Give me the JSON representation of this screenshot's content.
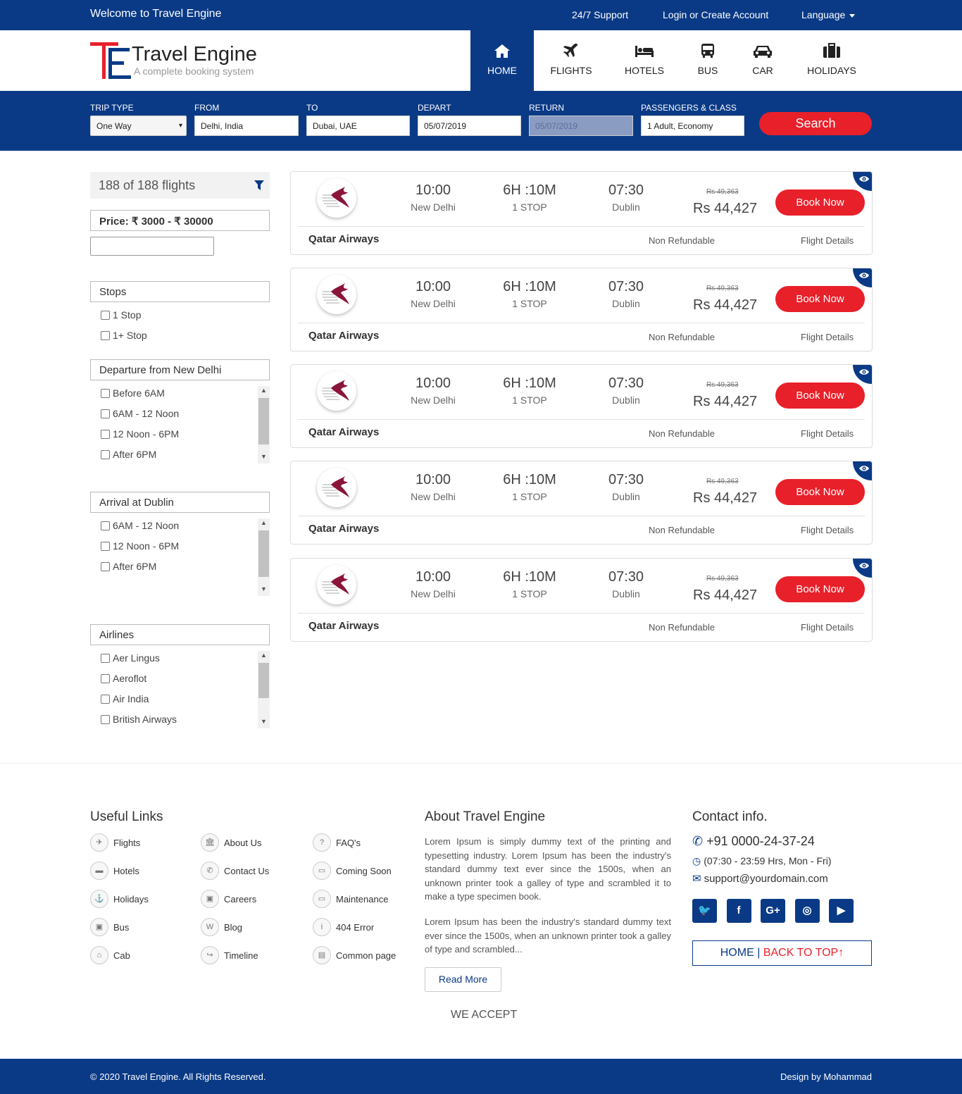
{
  "topbar": {
    "welcome": "Welcome to Travel Engine",
    "support": "24/7 Support",
    "login": "Login or Create Account",
    "language": "Language"
  },
  "logo": {
    "name": "Travel Engine",
    "tagline": "A complete booking system",
    "mark": "TE"
  },
  "nav": [
    {
      "label": "HOME",
      "icon": "home-icon",
      "active": true
    },
    {
      "label": "FLIGHTS",
      "icon": "plane-icon"
    },
    {
      "label": "HOTELS",
      "icon": "bed-icon"
    },
    {
      "label": "BUS",
      "icon": "bus-icon"
    },
    {
      "label": "CAR",
      "icon": "car-icon"
    },
    {
      "label": "HOLIDAYS",
      "icon": "suitcase-icon"
    }
  ],
  "search": {
    "trip_type_label": "TRIP TYPE",
    "trip_type": "One Way",
    "from_label": "FROM",
    "from": "Delhi, India",
    "to_label": "TO",
    "to": "Dubai, UAE",
    "depart_label": "DEPART",
    "depart": "05/07/2019",
    "return_label": "RETURN",
    "return": "05/07/2019",
    "pax_label": "PASSENGERS & CLASS",
    "pax": "1 Adult, Economy",
    "button": "Search"
  },
  "filters": {
    "count": "188 of 188 flights",
    "price": "Price: ₹ 3000 - ₹ 30000",
    "stops": {
      "title": "Stops",
      "options": [
        "1 Stop",
        "1+ Stop"
      ]
    },
    "departure": {
      "title": "Departure from New Delhi",
      "options": [
        "Before 6AM",
        "6AM - 12 Noon",
        "12 Noon - 6PM",
        "After 6PM"
      ]
    },
    "arrival": {
      "title": "Arrival at Dublin",
      "options": [
        "6AM - 12 Noon",
        "12 Noon - 6PM",
        "After 6PM"
      ]
    },
    "airlines": {
      "title": "Airlines",
      "options": [
        "Aer Lingus",
        "Aeroflot",
        "Air India",
        "British Airways"
      ]
    }
  },
  "flights": [
    {
      "dep_time": "10:00",
      "dep_city": "New Delhi",
      "duration": "6H :10M",
      "stops": "1 STOP",
      "arr_time": "07:30",
      "arr_city": "Dublin",
      "old_price": "Rs 49,363",
      "price": "Rs 44,427",
      "book": "Book Now",
      "airline": "Qatar Airways",
      "refund": "Non Refundable",
      "details": "Flight Details"
    },
    {
      "dep_time": "10:00",
      "dep_city": "New Delhi",
      "duration": "6H :10M",
      "stops": "1 STOP",
      "arr_time": "07:30",
      "arr_city": "Dublin",
      "old_price": "Rs 49,363",
      "price": "Rs 44,427",
      "book": "Book Now",
      "airline": "Qatar Airways",
      "refund": "Non Refundable",
      "details": "Flight Details"
    },
    {
      "dep_time": "10:00",
      "dep_city": "New Delhi",
      "duration": "6H :10M",
      "stops": "1 STOP",
      "arr_time": "07:30",
      "arr_city": "Dublin",
      "old_price": "Rs 49,363",
      "price": "Rs 44,427",
      "book": "Book Now",
      "airline": "Qatar Airways",
      "refund": "Non Refundable",
      "details": "Flight Details"
    },
    {
      "dep_time": "10:00",
      "dep_city": "New Delhi",
      "duration": "6H :10M",
      "stops": "1 STOP",
      "arr_time": "07:30",
      "arr_city": "Dublin",
      "old_price": "Rs 49,363",
      "price": "Rs 44,427",
      "book": "Book Now",
      "airline": "Qatar Airways",
      "refund": "Non Refundable",
      "details": "Flight Details"
    },
    {
      "dep_time": "10:00",
      "dep_city": "New Delhi",
      "duration": "6H :10M",
      "stops": "1 STOP",
      "arr_time": "07:30",
      "arr_city": "Dublin",
      "old_price": "Rs 49,363",
      "price": "Rs 44,427",
      "book": "Book Now",
      "airline": "Qatar Airways",
      "refund": "Non Refundable",
      "details": "Flight Details"
    }
  ],
  "footer": {
    "useful_title": "Useful Links",
    "links": [
      {
        "label": "Flights",
        "icon": "plane-icon",
        "glyph": "✈"
      },
      {
        "label": "About Us",
        "icon": "bank-icon",
        "glyph": "🏛"
      },
      {
        "label": "FAQ's",
        "icon": "question-icon",
        "glyph": "?"
      },
      {
        "label": "Hotels",
        "icon": "bed-icon",
        "glyph": "▬"
      },
      {
        "label": "Contact Us",
        "icon": "phone-icon",
        "glyph": "✆"
      },
      {
        "label": "Coming Soon",
        "icon": "laptop-icon",
        "glyph": "▭"
      },
      {
        "label": "Holidays",
        "icon": "anchor-icon",
        "glyph": "⚓"
      },
      {
        "label": "Careers",
        "icon": "briefcase-icon",
        "glyph": "▣"
      },
      {
        "label": "Maintenance",
        "icon": "desktop-icon",
        "glyph": "▭"
      },
      {
        "label": "Bus",
        "icon": "suitcase-icon",
        "glyph": "▣"
      },
      {
        "label": "Blog",
        "icon": "wordpress-icon",
        "glyph": "W"
      },
      {
        "label": "404 Error",
        "icon": "info-icon",
        "glyph": "i"
      },
      {
        "label": "Cab",
        "icon": "home-icon",
        "glyph": "⌂"
      },
      {
        "label": "Timeline",
        "icon": "share-icon",
        "glyph": "↪"
      },
      {
        "label": "Common page",
        "icon": "file-icon",
        "glyph": "▤"
      }
    ],
    "about_title": "About Travel Engine",
    "about_p1": "Lorem Ipsum is simply dummy text of the printing and typesetting industry. Lorem Ipsum has been the industry's standard dummy text ever since the 1500s, when an unknown printer took a galley of type and scrambled it to make a type specimen book.",
    "about_p2": "Lorem Ipsum has been the industry's standard dummy text ever since the 1500s, when an unknown printer took a galley of type and scrambled...",
    "read_more": "Read More",
    "we_accept": "WE ACCEPT",
    "contact_title": "Contact info.",
    "phone": "+91 0000-24-37-24",
    "hours": "(07:30 - 23:59 Hrs, Mon - Fri)",
    "email": "support@yourdomain.com",
    "social": [
      {
        "icon": "twitter-icon",
        "glyph": "🐦"
      },
      {
        "icon": "facebook-icon",
        "glyph": "f"
      },
      {
        "icon": "google-plus-icon",
        "glyph": "G+"
      },
      {
        "icon": "instagram-icon",
        "glyph": "◎"
      },
      {
        "icon": "youtube-icon",
        "glyph": "▶"
      }
    ],
    "home": "HOME",
    "sep": "|",
    "back_to_top": "BACK TO TOP"
  },
  "bottom": {
    "copyright": "© 2020 Travel Engine. All Rights Reserved.",
    "credit": "Design by Mohammad"
  },
  "colors": {
    "primary": "#0a3a86",
    "accent": "#e8202a",
    "airline": "#8a1538"
  }
}
